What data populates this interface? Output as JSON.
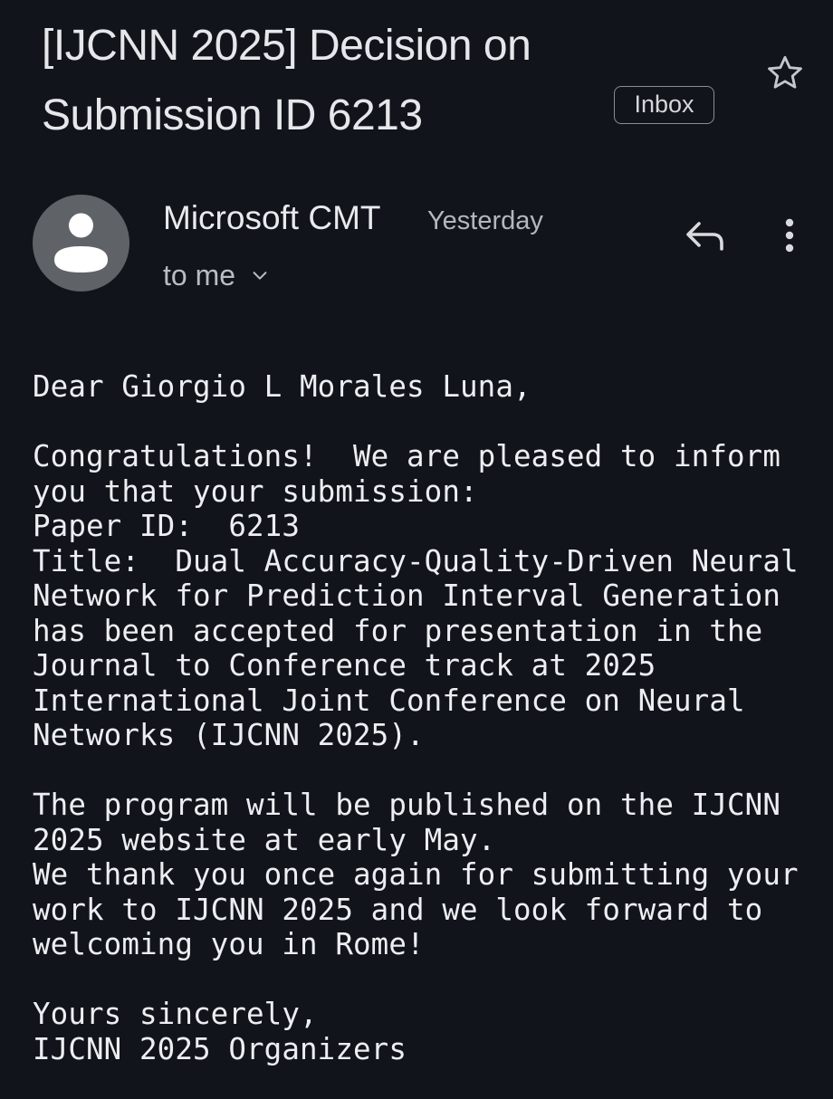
{
  "email": {
    "subject": "[IJCNN 2025] Decision on Submission ID 6213",
    "label": "Inbox",
    "sender": "Microsoft CMT",
    "time": "Yesterday",
    "recipient": "to me",
    "body": "Dear Giorgio L Morales Luna,\n\nCongratulations!  We are pleased to inform\nyou that your submission:\nPaper ID:  6213\nTitle:  Dual Accuracy-Quality-Driven Neural\nNetwork for Prediction Interval Generation\nhas been accepted for presentation in the\nJournal to Conference track at 2025\nInternational Joint Conference on Neural\nNetworks (IJCNN 2025).\n\nThe program will be published on the IJCNN\n2025 website at early May.\nWe thank you once again for submitting your\nwork to IJCNN 2025 and we look forward to\nwelcoming you in Rome!\n\nYours sincerely,\nIJCNN 2025 Organizers"
  },
  "icons": {
    "star": "star-outline-icon",
    "avatar": "person-icon",
    "recipient_toggle": "chevron-down-icon",
    "reply": "reply-icon",
    "more": "more-vert-icon"
  },
  "colors": {
    "background": "#11141b",
    "text": "#e8eaed",
    "muted": "#b4b7bc",
    "avatar_bg": "#5f6368"
  }
}
